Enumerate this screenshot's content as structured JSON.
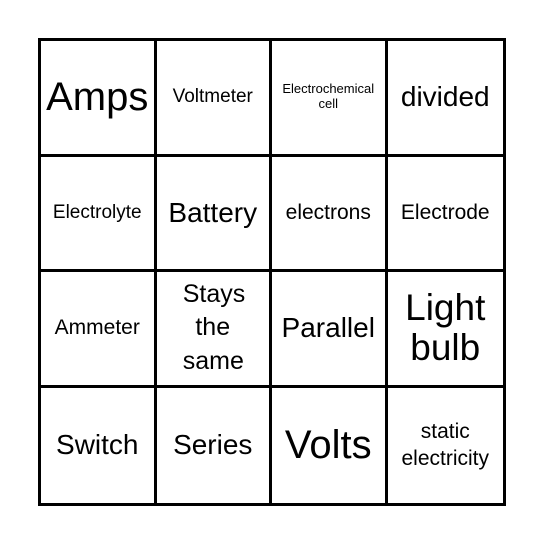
{
  "card": {
    "cells": [
      {
        "text": "Amps",
        "size": "s-huge"
      },
      {
        "text": "Voltmeter",
        "size": "s-sm"
      },
      {
        "text": "Electrochemical cell",
        "size": "s-xs"
      },
      {
        "text": "divided",
        "size": "s-xl"
      },
      {
        "text": "Electrolyte",
        "size": "s-sm"
      },
      {
        "text": "Battery",
        "size": "s-xl"
      },
      {
        "text": "electrons",
        "size": "s-md"
      },
      {
        "text": "Electrode",
        "size": "s-md"
      },
      {
        "text": "Ammeter",
        "size": "s-md"
      },
      {
        "text": "Stays the same",
        "size": "s-lg"
      },
      {
        "text": "Parallel",
        "size": "s-xl"
      },
      {
        "text": "Light bulb",
        "size": "s-xxl"
      },
      {
        "text": "Switch",
        "size": "s-xl"
      },
      {
        "text": "Series",
        "size": "s-xl"
      },
      {
        "text": "Volts",
        "size": "s-huge"
      },
      {
        "text": "static electricity",
        "size": "s-md"
      }
    ]
  }
}
